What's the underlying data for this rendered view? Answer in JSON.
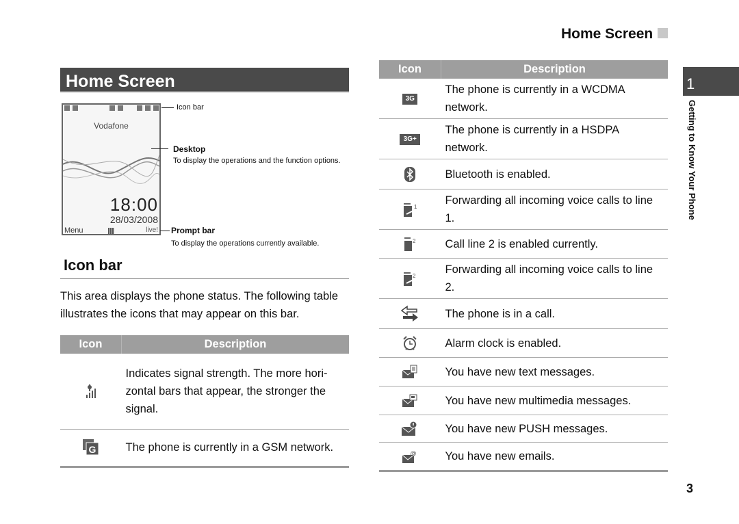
{
  "running_header": "Home Screen",
  "section_title": "Home Screen",
  "phone_screen": {
    "carrier": "Vodafone",
    "time": "18:00",
    "date": "28/03/2008",
    "left_softkey": "Menu",
    "right_softkey": "live!"
  },
  "callouts": {
    "icon_bar": {
      "label": "Icon bar"
    },
    "desktop": {
      "title": "Desktop",
      "description": "To display the operations and the function options."
    },
    "prompt_bar": {
      "title": "Prompt bar",
      "description": "To display the operations currently available."
    }
  },
  "subsection_title": "Icon bar",
  "intro_text": "This area displays the phone status. The following table illustrates the icons that may appear on this bar.",
  "table_headers": {
    "icon": "Icon",
    "description": "Description"
  },
  "left_table": [
    {
      "icon": "signal-strength-icon",
      "glyph": "📶",
      "description": "Indicates signal strength. The more hori-zontal bars that appear, the stronger the signal."
    },
    {
      "icon": "gsm-network-icon",
      "glyph": "G",
      "description": "The phone is currently in a GSM network."
    }
  ],
  "right_table": [
    {
      "icon": "wcdma-network-icon",
      "glyph": "3G",
      "description": "The phone is currently in a WCDMA network."
    },
    {
      "icon": "hsdpa-network-icon",
      "glyph": "3G+",
      "description": "The phone is currently in a HSDPA network."
    },
    {
      "icon": "bluetooth-icon",
      "glyph": "ᛒ",
      "description": "Bluetooth is enabled."
    },
    {
      "icon": "forward-line1-icon",
      "glyph": "↪1",
      "description": "Forwarding all incoming voice calls to line 1."
    },
    {
      "icon": "call-line2-icon",
      "glyph": "▮2",
      "description": "Call line 2 is enabled currently."
    },
    {
      "icon": "forward-line2-icon",
      "glyph": "↪2",
      "description": "Forwarding all incoming voice calls to line 2."
    },
    {
      "icon": "in-call-icon",
      "glyph": "⇆",
      "description": "The phone is in a call."
    },
    {
      "icon": "alarm-clock-icon",
      "glyph": "⏰",
      "description": "Alarm clock is enabled."
    },
    {
      "icon": "text-message-icon",
      "glyph": "✉",
      "description": "You have new text messages."
    },
    {
      "icon": "multimedia-message-icon",
      "glyph": "✉",
      "description": "You have new multimedia messages."
    },
    {
      "icon": "push-message-icon",
      "glyph": "✉",
      "description": "You have new PUSH messages."
    },
    {
      "icon": "email-icon",
      "glyph": "✉",
      "description": "You have new emails."
    }
  ],
  "chapter": {
    "number": "1",
    "title": "Getting to Know Your Phone"
  },
  "page_number": "3"
}
